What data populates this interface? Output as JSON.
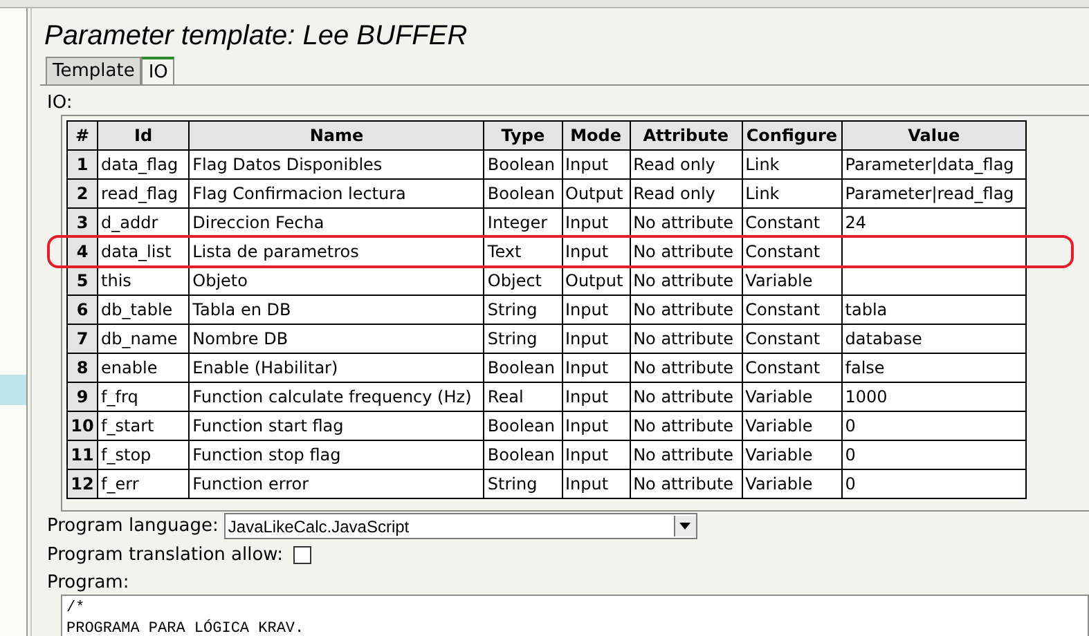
{
  "title": "Parameter template: Lee BUFFER",
  "tabs": [
    {
      "label": "Template",
      "selected": false
    },
    {
      "label": "IO",
      "selected": true
    }
  ],
  "io_label": "IO:",
  "table": {
    "columns": [
      "#",
      "Id",
      "Name",
      "Type",
      "Mode",
      "Attribute",
      "Configure",
      "Value"
    ],
    "rows": [
      {
        "cells": [
          "1",
          "data_flag",
          "Flag Datos Disponibles",
          "Boolean",
          "Input",
          "Read only",
          "Link",
          "Parameter|data_flag"
        ],
        "highlighted": false
      },
      {
        "cells": [
          "2",
          "read_flag",
          "Flag Confirmacion lectura",
          "Boolean",
          "Output",
          "Read only",
          "Link",
          "Parameter|read_flag"
        ],
        "highlighted": false
      },
      {
        "cells": [
          "3",
          "d_addr",
          "Direccion Fecha",
          "Integer",
          "Input",
          "No attribute",
          "Constant",
          "24"
        ],
        "highlighted": false
      },
      {
        "cells": [
          "4",
          "data_list",
          "Lista de parametros",
          "Text",
          "Input",
          "No attribute",
          "Constant",
          ""
        ],
        "highlighted": true
      },
      {
        "cells": [
          "5",
          "this",
          "Objeto",
          "Object",
          "Output",
          "No attribute",
          "Variable",
          ""
        ],
        "highlighted": false
      },
      {
        "cells": [
          "6",
          "db_table",
          "Tabla en DB",
          "String",
          "Input",
          "No attribute",
          "Constant",
          "tabla"
        ],
        "highlighted": false
      },
      {
        "cells": [
          "7",
          "db_name",
          "Nombre DB",
          "String",
          "Input",
          "No attribute",
          "Constant",
          "database"
        ],
        "highlighted": false
      },
      {
        "cells": [
          "8",
          "enable",
          "Enable (Habilitar)",
          "Boolean",
          "Input",
          "No attribute",
          "Constant",
          "false"
        ],
        "highlighted": false
      },
      {
        "cells": [
          "9",
          "f_frq",
          "Function calculate frequency (Hz)",
          "Real",
          "Input",
          "No attribute",
          "Variable",
          "1000"
        ],
        "highlighted": false
      },
      {
        "cells": [
          "10",
          "f_start",
          "Function start flag",
          "Boolean",
          "Input",
          "No attribute",
          "Variable",
          "0"
        ],
        "highlighted": false
      },
      {
        "cells": [
          "11",
          "f_stop",
          "Function stop flag",
          "Boolean",
          "Input",
          "No attribute",
          "Variable",
          "0"
        ],
        "highlighted": false
      },
      {
        "cells": [
          "12",
          "f_err",
          "Function error",
          "String",
          "Input",
          "No attribute",
          "Variable",
          "0"
        ],
        "highlighted": false
      }
    ]
  },
  "language": {
    "label": "Program language:",
    "value": "JavaLikeCalc.JavaScript"
  },
  "translation": {
    "label": "Program translation allow:",
    "checked": false
  },
  "program": {
    "label": "Program:",
    "lines": [
      "/*",
      "PROGRAMA PARA LÓGICA KRAV."
    ]
  }
}
